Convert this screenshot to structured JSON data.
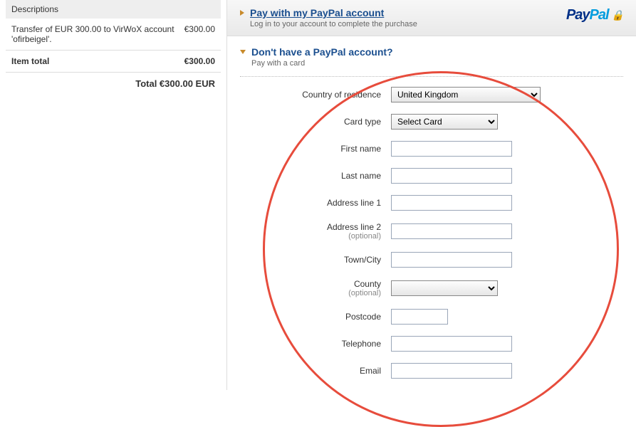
{
  "sidebar": {
    "header": "Descriptions",
    "line_item_desc": "Transfer of EUR 300.00 to VirWoX account 'ofirbeigel'.",
    "line_item_amount": "€300.00",
    "item_total_label": "Item total",
    "item_total_amount": "€300.00",
    "grand_total": "Total €300.00 EUR"
  },
  "header": {
    "title": "Pay with my PayPal account",
    "subtitle": "Log in to your account to complete the purchase",
    "brand_pay": "Pay",
    "brand_pal": "Pal"
  },
  "section2": {
    "title": "Don't have a PayPal account?",
    "subtitle": "Pay with a card"
  },
  "form": {
    "optional_text": "(optional)",
    "country": {
      "label": "Country of residence",
      "value": "United Kingdom"
    },
    "card_type": {
      "label": "Card type",
      "value": "Select Card"
    },
    "first_name": {
      "label": "First name"
    },
    "last_name": {
      "label": "Last name"
    },
    "addr1": {
      "label": "Address line 1"
    },
    "addr2": {
      "label": "Address line 2"
    },
    "town": {
      "label": "Town/City"
    },
    "county": {
      "label": "County"
    },
    "postcode": {
      "label": "Postcode"
    },
    "telephone": {
      "label": "Telephone"
    },
    "email": {
      "label": "Email"
    }
  }
}
